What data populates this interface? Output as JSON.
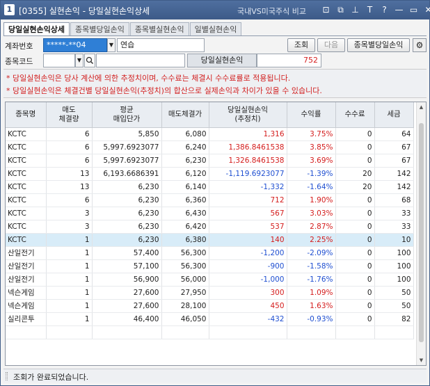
{
  "window": {
    "number": "1",
    "title": "[0355] 실현손익 - 당일실현손익상세",
    "right_title": "국내VS미국주식 비교",
    "icons": [
      "pin-icon",
      "copy-icon",
      "pushpin-icon",
      "text-icon",
      "help-icon",
      "minimize-icon",
      "maximize-icon",
      "close-icon"
    ],
    "icon_glyphs": [
      "⊡",
      "⧉",
      "⊥",
      "T",
      "?",
      "—",
      "▭",
      "✕"
    ]
  },
  "tabs": [
    {
      "label": "당일실현손익상세",
      "active": true
    },
    {
      "label": "종목별당일손익",
      "active": false
    },
    {
      "label": "종목별실현손익",
      "active": false
    },
    {
      "label": "일별실현손익",
      "active": false
    }
  ],
  "form": {
    "account_label": "계좌번호",
    "account_value": "*****-**04",
    "account_name": "연습",
    "code_label": "종목코드",
    "code_value": "",
    "search_button": "조회",
    "next_button": "다음",
    "by_item_button": "종목별당일손익",
    "pl_label": "당일실현손익",
    "pl_value": "752"
  },
  "notes": [
    "* 당일실현손익은 당사 계산에 의한 추정치이며, 수수료는 체결시 수수료률로 적용됩니다.",
    "* 당일실현손익은 체결건별 당일실현손익(추정치)의 합산으로 실제손익과 차이가 있을 수 있습니다."
  ],
  "table": {
    "headers": [
      "종목명",
      "매도\n체결량",
      "평균\n매입단가",
      "매도체결가",
      "당일실현손익\n(추정치)",
      "수익률",
      "수수료",
      "세금"
    ],
    "rows": [
      {
        "name": "KCTC",
        "qty": "6",
        "avg": "5,850",
        "sell": "6,080",
        "pl": "1,316",
        "rate": "3.75%",
        "fee": "0",
        "tax": "64",
        "sign": "pos"
      },
      {
        "name": "KCTC",
        "qty": "6",
        "avg": "5,997.6923077",
        "sell": "6,240",
        "pl": "1,386.8461538",
        "rate": "3.85%",
        "fee": "0",
        "tax": "67",
        "sign": "pos"
      },
      {
        "name": "KCTC",
        "qty": "6",
        "avg": "5,997.6923077",
        "sell": "6,230",
        "pl": "1,326.8461538",
        "rate": "3.69%",
        "fee": "0",
        "tax": "67",
        "sign": "pos"
      },
      {
        "name": "KCTC",
        "qty": "13",
        "avg": "6,193.6686391",
        "sell": "6,120",
        "pl": "-1,119.6923077",
        "rate": "-1.39%",
        "fee": "20",
        "tax": "142",
        "sign": "neg"
      },
      {
        "name": "KCTC",
        "qty": "13",
        "avg": "6,230",
        "sell": "6,140",
        "pl": "-1,332",
        "rate": "-1.64%",
        "fee": "20",
        "tax": "142",
        "sign": "neg"
      },
      {
        "name": "KCTC",
        "qty": "6",
        "avg": "6,230",
        "sell": "6,360",
        "pl": "712",
        "rate": "1.90%",
        "fee": "0",
        "tax": "68",
        "sign": "pos"
      },
      {
        "name": "KCTC",
        "qty": "3",
        "avg": "6,230",
        "sell": "6,430",
        "pl": "567",
        "rate": "3.03%",
        "fee": "0",
        "tax": "33",
        "sign": "pos"
      },
      {
        "name": "KCTC",
        "qty": "3",
        "avg": "6,230",
        "sell": "6,420",
        "pl": "537",
        "rate": "2.87%",
        "fee": "0",
        "tax": "33",
        "sign": "pos"
      },
      {
        "name": "KCTC",
        "qty": "1",
        "avg": "6,230",
        "sell": "6,380",
        "pl": "140",
        "rate": "2.25%",
        "fee": "0",
        "tax": "10",
        "sign": "pos",
        "selected": true
      },
      {
        "name": "산일전기",
        "qty": "1",
        "avg": "57,400",
        "sell": "56,300",
        "pl": "-1,200",
        "rate": "-2.09%",
        "fee": "0",
        "tax": "100",
        "sign": "neg"
      },
      {
        "name": "산일전기",
        "qty": "1",
        "avg": "57,100",
        "sell": "56,300",
        "pl": "-900",
        "rate": "-1.58%",
        "fee": "0",
        "tax": "100",
        "sign": "neg"
      },
      {
        "name": "산일전기",
        "qty": "1",
        "avg": "56,900",
        "sell": "56,000",
        "pl": "-1,000",
        "rate": "-1.76%",
        "fee": "0",
        "tax": "100",
        "sign": "neg"
      },
      {
        "name": "넥슨게임",
        "qty": "1",
        "avg": "27,600",
        "sell": "27,950",
        "pl": "300",
        "rate": "1.09%",
        "fee": "0",
        "tax": "50",
        "sign": "pos"
      },
      {
        "name": "넥슨게임",
        "qty": "1",
        "avg": "27,600",
        "sell": "28,100",
        "pl": "450",
        "rate": "1.63%",
        "fee": "0",
        "tax": "50",
        "sign": "pos"
      },
      {
        "name": "실리콘투",
        "qty": "1",
        "avg": "46,400",
        "sell": "46,050",
        "pl": "-432",
        "rate": "-0.93%",
        "fee": "0",
        "tax": "82",
        "sign": "neg"
      }
    ]
  },
  "colors": {
    "positive": "#d41c1c",
    "negative": "#1f4fd1",
    "titlebar": "#3c5a88"
  },
  "status": "조회가 완료되었습니다."
}
